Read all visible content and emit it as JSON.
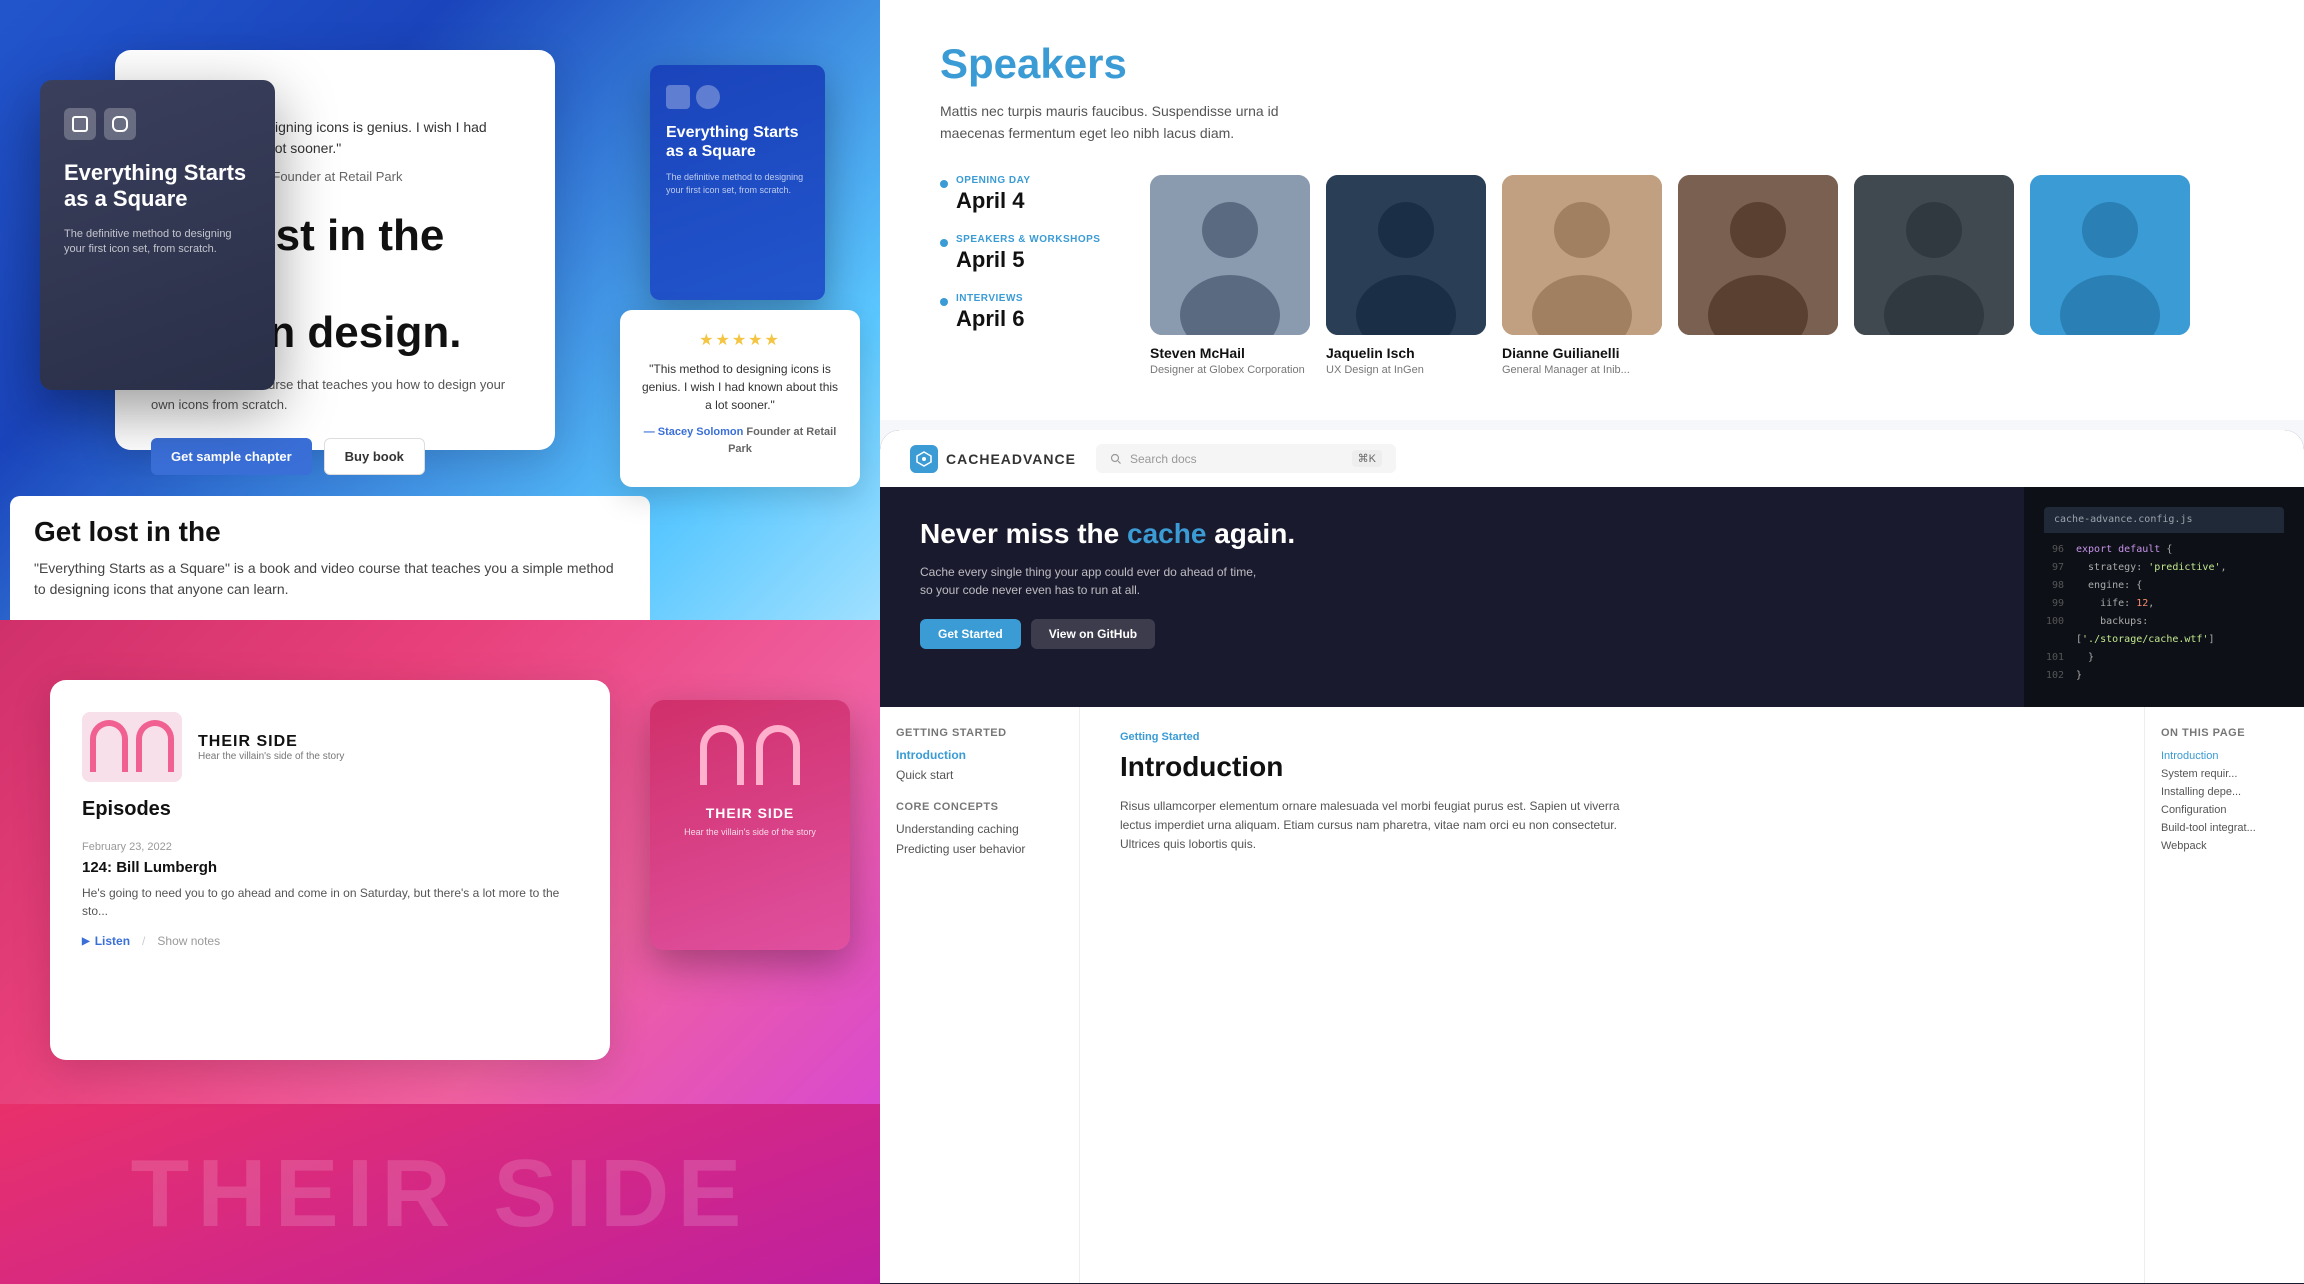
{
  "leftPanel": {
    "bookSection": {
      "mainCard": {
        "title": "Everything Starts as a Square",
        "subtitle": "The definitive method to designing your first icon set, from scratch."
      },
      "reviewCard": {
        "stars": "★★★★",
        "review": "\"This method to designing icons is genius. I wish I had known about this a lot sooner.\"",
        "author": "— Stacey Solomon",
        "authorRole": "Founder at Retail Park",
        "heading1": "Get lost in the world",
        "heading2": "of icon design.",
        "description": "A book and video course that teaches you how to design your own icons from scratch.",
        "btnSample": "Get sample chapter",
        "btnBuy": "Buy book"
      },
      "smallCard": {
        "title": "Everything Starts as a Square",
        "desc": "The definitive method to designing your first icon set, from scratch."
      },
      "floatingReview": {
        "stars": "★★★★★",
        "text": "\"This method to designing icons is genius. I wish I had known about this a lot sooner.\"",
        "author": "— Stacey Solomon",
        "authorRole": "Founder at Retail Park"
      },
      "bottomText": "\"Everything Starts as a Square\" is a book and video course that teaches you a simple method to designing icons that anyone can learn.",
      "bottomHeading": "Get lost in the"
    },
    "podcastSection": {
      "card": {
        "heading": "Episodes",
        "episodeDate": "February 23, 2022",
        "episodeNumber": "124: Bill Lumbergh",
        "episodeDesc": "He's going to need you to go ahead and come in on Saturday, but there's a lot more to the sto...",
        "listenLabel": "Listen",
        "showNotesLabel": "Show notes"
      },
      "smallCard": {
        "title": "THEIR SIDE",
        "subtitle": "Hear the villain's side of the story"
      },
      "bottomText": "theiR SIDE"
    }
  },
  "rightPanel": {
    "speakers": {
      "title": "Speakers",
      "description": "Mattis nec turpis mauris faucibus. Suspendisse urna id maecenas fermentum eget leo nibh lacus diam.",
      "schedule": [
        {
          "label": "Opening Day",
          "date": "April 4",
          "active": true
        },
        {
          "label": "Speakers & Workshops",
          "date": "April 5",
          "active": false
        },
        {
          "label": "Interviews",
          "date": "April 6",
          "active": false
        }
      ],
      "speakersList": [
        {
          "name": "Steven McHail",
          "role": "Designer at Globex Corporation"
        },
        {
          "name": "Jaquelin Isch",
          "role": "UX Design at InGen"
        },
        {
          "name": "Dianne Guilianelli",
          "role": "General Manager at Inib..."
        }
      ]
    },
    "cache": {
      "nav": {
        "logoText": "CACHEADVANCE",
        "searchPlaceholder": "Search docs",
        "kbd": "⌘K"
      },
      "hero": {
        "headline1": "Never miss the",
        "headlineHighlight": "cache",
        "headline2": "again.",
        "description": "Cache every single thing your app could ever do ahead of time, so your code never even has to run at all.",
        "btnGetStarted": "Get Started",
        "btnGithub": "View on GitHub"
      },
      "code": {
        "filename": "cache-advance.config.js",
        "lines": [
          {
            "num": "96",
            "text": "export default {"
          },
          {
            "num": "97",
            "text": "  strategy: 'predictive',"
          },
          {
            "num": "98",
            "text": "  engine: {"
          },
          {
            "num": "99",
            "text": "    iife: 12,"
          },
          {
            "num": "100",
            "text": "    backups: ['./storage/cache.wtf']"
          },
          {
            "num": "101",
            "text": "  }"
          },
          {
            "num": "102",
            "text": "}"
          }
        ]
      },
      "docs": {
        "sidebarSections": [
          {
            "heading": "Getting started",
            "items": [
              {
                "label": "Introduction",
                "active": true
              },
              {
                "label": "Quick start",
                "active": false
              }
            ]
          },
          {
            "heading": "Core concepts",
            "items": [
              {
                "label": "Understanding caching",
                "active": false
              },
              {
                "label": "Predicting user behavior",
                "active": false
              }
            ]
          }
        ],
        "mainHeading": "Introduction",
        "mainText": "Risus ullamcorper elementum ornare malesuada vel morbi feugiat purus est. Sapien ut viverra lectus imperdiet urna aliquam. Etiam cursus nam pharetra, vitae nam orci eu non consectetur. Ultrices quis lobortis quis.",
        "rightSidebar": {
          "heading": "On this page",
          "items": [
            {
              "label": "Introduction",
              "active": true
            },
            {
              "label": "System requir...",
              "active": false
            },
            {
              "label": "Installing depe...",
              "active": false
            },
            {
              "label": "Configuration",
              "active": false
            },
            {
              "label": "Build-tool integrat...",
              "active": false
            },
            {
              "label": "Webpack",
              "active": false
            }
          ]
        }
      }
    }
  }
}
